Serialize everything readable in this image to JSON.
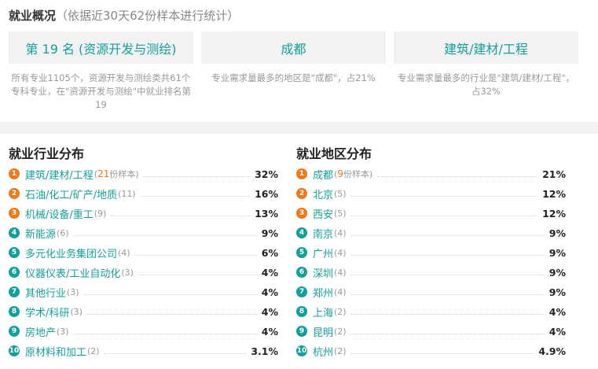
{
  "overview": {
    "title": "就业概况",
    "note": "（依据近30天62份样本进行统计）",
    "cards": [
      {
        "value": "第 19 名 (资源开发与测绘)",
        "desc": "所有专业1105个，资源开发与测绘类共61个专科专业，在\"资源开发与测绘\"中就业排名第19"
      },
      {
        "value": "成都",
        "desc": "专业需求量最多的地区是\"成都\"，占21%"
      },
      {
        "value": "建筑/建材/工程",
        "desc": "专业需求量最多的行业是\"建筑/建材/工程\"，占32%"
      }
    ]
  },
  "industry": {
    "title": "就业行业分布",
    "sample_suffix": "份样本",
    "items": [
      {
        "rank": "1",
        "name": "建筑/建材/工程",
        "count": "21",
        "pct": "32%"
      },
      {
        "rank": "2",
        "name": "石油/化工/矿产/地质",
        "count": "(11)",
        "pct": "16%"
      },
      {
        "rank": "3",
        "name": "机械/设备/重工",
        "count": "(9)",
        "pct": "13%"
      },
      {
        "rank": "4",
        "name": "新能源",
        "count": "(6)",
        "pct": "9%"
      },
      {
        "rank": "5",
        "name": "多元化业务集团公司",
        "count": "(4)",
        "pct": "6%"
      },
      {
        "rank": "6",
        "name": "仪器仪表/工业自动化",
        "count": "(3)",
        "pct": "4%"
      },
      {
        "rank": "7",
        "name": "其他行业",
        "count": "(3)",
        "pct": "4%"
      },
      {
        "rank": "8",
        "name": "学术/科研",
        "count": "(3)",
        "pct": "4%"
      },
      {
        "rank": "9",
        "name": "房地产",
        "count": "(3)",
        "pct": "4%"
      },
      {
        "rank": "10",
        "name": "原材料和加工",
        "count": "(2)",
        "pct": "3.1%"
      }
    ]
  },
  "region": {
    "title": "就业地区分布",
    "sample_suffix": "份样本",
    "items": [
      {
        "rank": "1",
        "name": "成都",
        "count": "9",
        "pct": "21%"
      },
      {
        "rank": "2",
        "name": "北京",
        "count": "(5)",
        "pct": "12%"
      },
      {
        "rank": "3",
        "name": "西安",
        "count": "(5)",
        "pct": "12%"
      },
      {
        "rank": "4",
        "name": "南京",
        "count": "(4)",
        "pct": "9%"
      },
      {
        "rank": "5",
        "name": "广州",
        "count": "(4)",
        "pct": "9%"
      },
      {
        "rank": "6",
        "name": "深圳",
        "count": "(4)",
        "pct": "9%"
      },
      {
        "rank": "7",
        "name": "郑州",
        "count": "(4)",
        "pct": "9%"
      },
      {
        "rank": "8",
        "name": "上海",
        "count": "(2)",
        "pct": "4%"
      },
      {
        "rank": "9",
        "name": "昆明",
        "count": "(2)",
        "pct": "4%"
      },
      {
        "rank": "10",
        "name": "杭州",
        "count": "(2)",
        "pct": "4.9%"
      }
    ]
  },
  "colors": {
    "accent": "#13a09c",
    "hot": "#f07a1a",
    "muted": "#999999"
  }
}
